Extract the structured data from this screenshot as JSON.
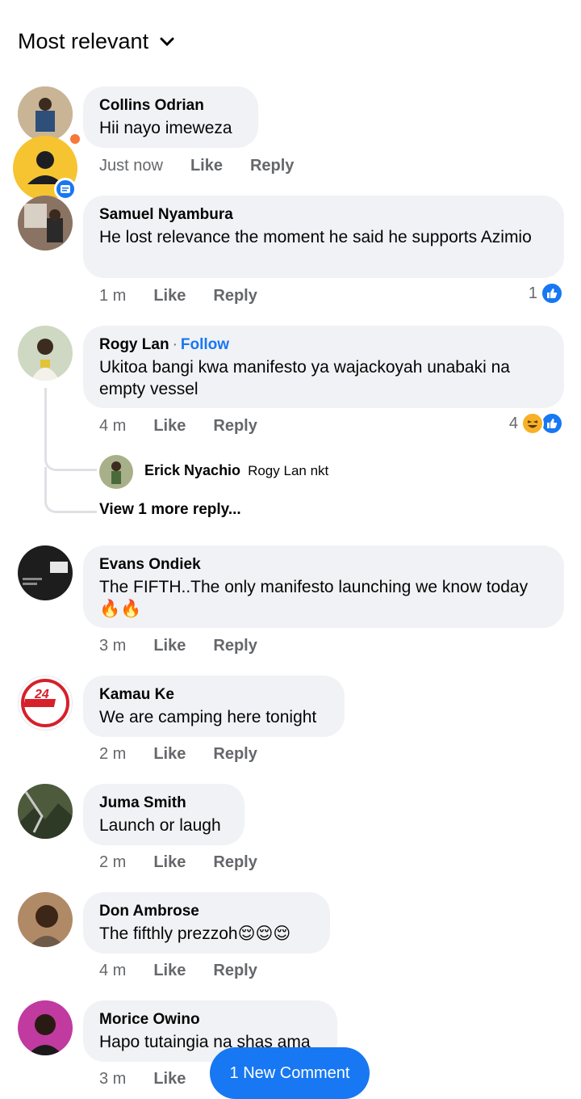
{
  "sort": {
    "label": "Most relevant"
  },
  "comments": [
    {
      "name": "Collins Odrian",
      "text": "Hii nayo imeweza",
      "time": "Just now",
      "like": "Like",
      "reply": "Reply"
    },
    {
      "name": "Samuel Nyambura",
      "text": "He lost relevance the moment he said he supports Azimio",
      "time": "1 m",
      "like": "Like",
      "reply": "Reply",
      "reaction_count": "1"
    },
    {
      "name": "Rogy Lan",
      "follow": "Follow",
      "text": "Ukitoa bangi kwa manifesto ya wajackoyah unabaki na empty vessel",
      "time": "4 m",
      "like": "Like",
      "reply": "Reply",
      "reaction_count": "4"
    },
    {
      "name": "Evans Ondiek",
      "text": "The FIFTH..The only manifesto launching we know today 🔥🔥",
      "time": "3 m",
      "like": "Like",
      "reply": "Reply"
    },
    {
      "name": "Kamau Ke",
      "text": "We are camping here tonight",
      "time": "2 m",
      "like": "Like",
      "reply": "Reply"
    },
    {
      "name": "Juma Smith",
      "text": "Launch or laugh",
      "time": "2 m",
      "like": "Like",
      "reply": "Reply"
    },
    {
      "name": "Don Ambrose",
      "text": "The fifthly prezzoh😌😌😌",
      "time": "4 m",
      "like": "Like",
      "reply": "Reply"
    },
    {
      "name": "Morice Owino",
      "text": "Hapo tutaingia na shas ama",
      "time": "3 m",
      "like": "Like"
    }
  ],
  "reply_preview": {
    "name": "Erick Nyachio",
    "text": "Rogy Lan nkt",
    "view_more": "View 1 more reply..."
  },
  "new_comment": {
    "label": "1 New Comment"
  },
  "colors": {
    "accent": "#1877f2",
    "bubble": "#f0f2f5",
    "meta": "#65676b"
  }
}
